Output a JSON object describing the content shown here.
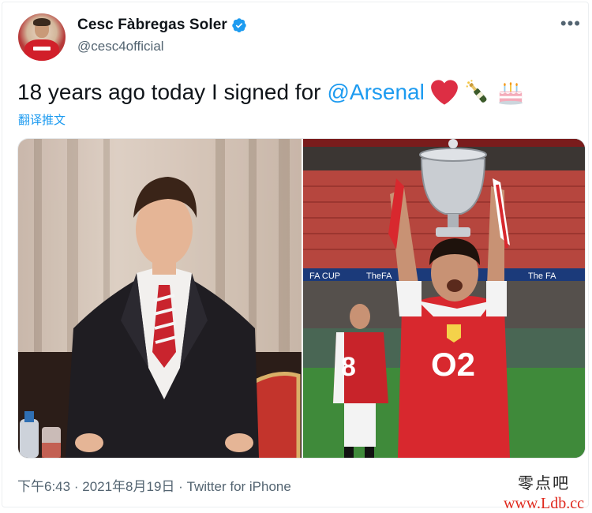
{
  "author": {
    "display_name": "Cesc Fàbregas Soler",
    "handle": "@cesc4official",
    "avatar_icon": "profile-avatar",
    "verified_icon": "verified-badge-icon"
  },
  "menu": {
    "more_label": "•••"
  },
  "tweet": {
    "text": "18 years ago today I signed for",
    "mention": "@Arsenal",
    "emojis": [
      "heart-emoji",
      "champagne-emoji",
      "cake-emoji"
    ],
    "translate_label": "翻译推文"
  },
  "media": {
    "photos": [
      {
        "subject": "young player in suit with red striped tie"
      },
      {
        "subject": "player holding FA Cup trophy in red O2 kit",
        "banner_left": "FA CUP",
        "banner_mid": "TheFA",
        "banner_right": "The FA",
        "shirt_sponsor": "O2",
        "back_number": "8"
      }
    ]
  },
  "meta": {
    "time": "下午6:43",
    "separator": "·",
    "date": "2021年8月19日",
    "source": "Twitter for iPhone"
  },
  "watermark": {
    "title": "零点吧",
    "url": "www.Ldb.cc"
  },
  "colors": {
    "link": "#1d9bf0",
    "secondary": "#536471",
    "arsenal_red": "#d8282e"
  }
}
